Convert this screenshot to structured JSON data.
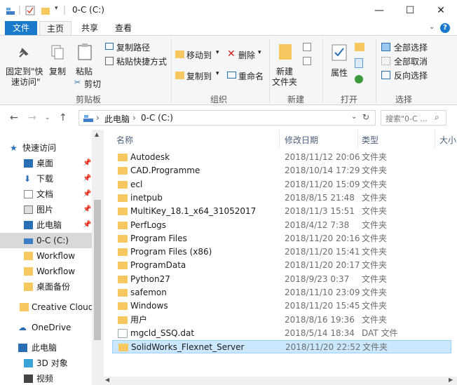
{
  "title": {
    "path": "0-C (C:)",
    "controls": {
      "minimize": "—",
      "maximize": "☐",
      "close": "✕"
    }
  },
  "tabs": [
    {
      "label": "文件"
    },
    {
      "label": "主页"
    },
    {
      "label": "共享"
    },
    {
      "label": "查看"
    }
  ],
  "ribbon": {
    "pin_label_1": "固定到\"快",
    "pin_label_2": "速访问\"",
    "copy": "复制",
    "paste": "粘贴",
    "copy_path": "复制路径",
    "paste_shortcut": "粘贴快捷方式",
    "cut": "剪切",
    "clipboard_group": "剪贴板",
    "move_to": "移动到",
    "copy_to": "复制到",
    "delete": "删除",
    "rename": "重命名",
    "organize_group": "组织",
    "new_folder_1": "新建",
    "new_folder_2": "文件夹",
    "new_group": "新建",
    "properties": "属性",
    "open_group": "打开",
    "select_all": "全部选择",
    "select_none": "全部取消",
    "invert": "反向选择",
    "select_group": "选择"
  },
  "address": {
    "crumbs": [
      "此电脑",
      "0-C (C:)"
    ],
    "search_placeholder": "搜索\"0-C ..."
  },
  "nav": {
    "quick_access": "快速访问",
    "items": [
      {
        "label": "桌面",
        "pinned": true
      },
      {
        "label": "下载",
        "pinned": true
      },
      {
        "label": "文档",
        "pinned": true
      },
      {
        "label": "图片",
        "pinned": true
      },
      {
        "label": "此电脑",
        "pinned": true
      },
      {
        "label": "0-C (C:)",
        "pinned": false
      },
      {
        "label": "Workflow",
        "pinned": false
      },
      {
        "label": "Workflow",
        "pinned": false
      },
      {
        "label": "桌面备份",
        "pinned": false
      }
    ],
    "creative_cloud": "Creative Cloud F",
    "onedrive": "OneDrive",
    "this_pc": "此电脑",
    "objects_3d": "3D 对象",
    "videos": "视频"
  },
  "columns": {
    "name": "名称",
    "date": "修改日期",
    "type": "类型",
    "size": "大小"
  },
  "files": [
    {
      "name": "Autodesk",
      "date": "2018/11/12 20:06",
      "type": "文件夹"
    },
    {
      "name": "CAD.Programme",
      "date": "2018/10/14 17:29",
      "type": "文件夹"
    },
    {
      "name": "ecl",
      "date": "2018/11/20 15:09",
      "type": "文件夹"
    },
    {
      "name": "inetpub",
      "date": "2018/8/15 21:48",
      "type": "文件夹"
    },
    {
      "name": "MultiKey_18.1_x64_31052017",
      "date": "2018/11/3 15:51",
      "type": "文件夹"
    },
    {
      "name": "PerfLogs",
      "date": "2018/4/12 7:38",
      "type": "文件夹"
    },
    {
      "name": "Program Files",
      "date": "2018/11/20 20:16",
      "type": "文件夹"
    },
    {
      "name": "Program Files (x86)",
      "date": "2018/11/20 15:41",
      "type": "文件夹"
    },
    {
      "name": "ProgramData",
      "date": "2018/11/20 20:17",
      "type": "文件夹"
    },
    {
      "name": "Python27",
      "date": "2018/9/23 0:37",
      "type": "文件夹"
    },
    {
      "name": "safemon",
      "date": "2018/11/10 23:09",
      "type": "文件夹"
    },
    {
      "name": "Windows",
      "date": "2018/11/20 15:45",
      "type": "文件夹"
    },
    {
      "name": "用户",
      "date": "2018/8/16 19:36",
      "type": "文件夹"
    },
    {
      "name": "mgcld_SSQ.dat",
      "date": "2018/5/14 18:34",
      "type": "DAT 文件"
    },
    {
      "name": "SolidWorks_Flexnet_Server",
      "date": "2018/11/20 22:52",
      "type": "文件夹"
    }
  ],
  "colors": {
    "accent": "#1979ca",
    "folder": "#f6c85f",
    "selected": "#cce8ff"
  }
}
